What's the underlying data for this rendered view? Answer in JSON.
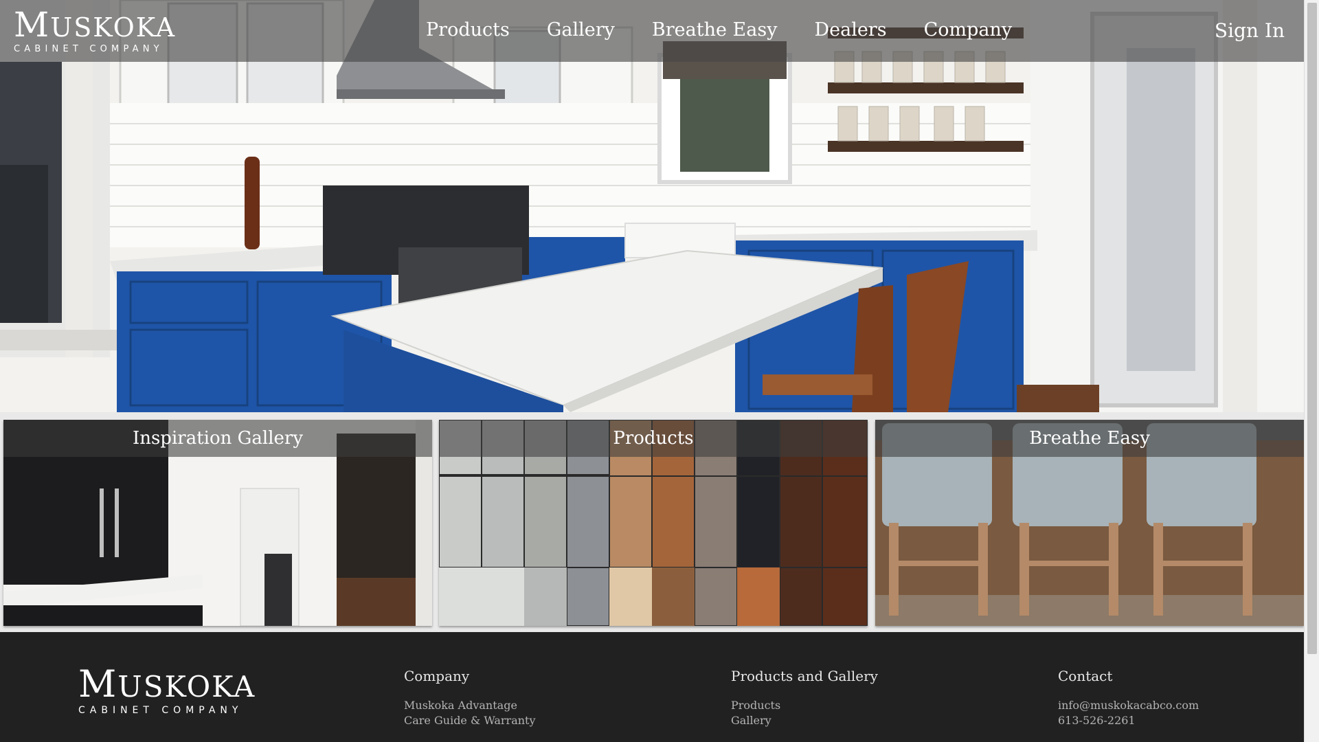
{
  "header": {
    "logo_word_first": "M",
    "logo_word_rest": "USKOKA",
    "logo_sub": "CABINET COMPANY",
    "nav": [
      "Products",
      "Gallery",
      "Breathe Easy",
      "Dealers",
      "Company"
    ],
    "sign_in": "Sign In"
  },
  "tiles": [
    {
      "label": "Inspiration Gallery"
    },
    {
      "label": "Products"
    },
    {
      "label": "Breathe Easy"
    }
  ],
  "footer": {
    "logo_word_first": "M",
    "logo_word_rest": "USKOKA",
    "logo_sub": "CABINET COMPANY",
    "columns": [
      {
        "title": "Company",
        "links": [
          "Muskoka Advantage",
          "Care Guide & Warranty"
        ]
      },
      {
        "title": "Products and Gallery",
        "links": [
          "Products",
          "Gallery"
        ]
      },
      {
        "title": "Contact",
        "links": [
          "info@muskokacabco.com",
          "613-526-2261"
        ]
      }
    ]
  },
  "colors": {
    "cabinet_blue": "#1f55a8",
    "topbar": "#464646",
    "footer_bg": "#212121"
  }
}
